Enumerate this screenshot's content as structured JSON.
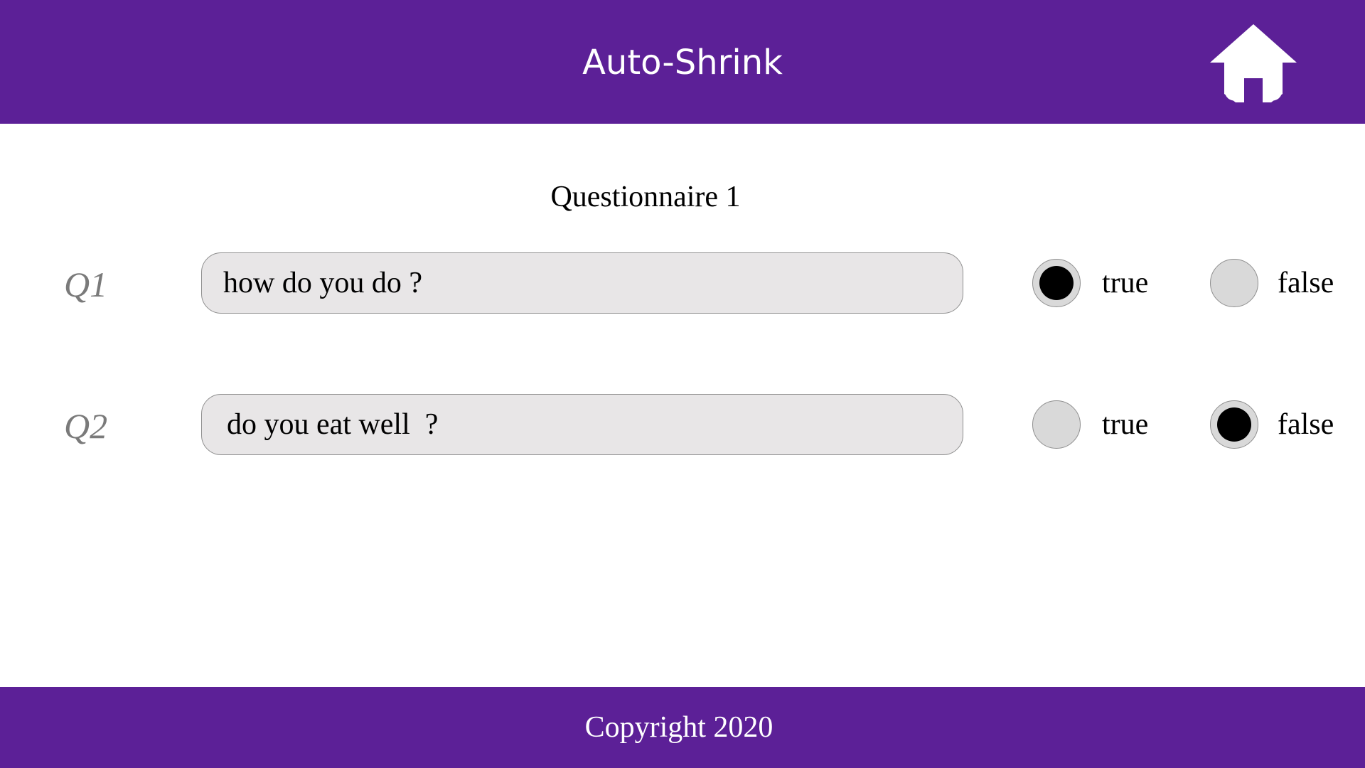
{
  "header": {
    "title": "Auto-Shrink",
    "home_icon": "home-icon",
    "color": "#5c2097"
  },
  "main": {
    "heading": "Questionnaire 1",
    "questions": [
      {
        "label": "Q1",
        "text": "how do you do ?",
        "options": [
          {
            "label": "true",
            "selected": true
          },
          {
            "label": "false",
            "selected": false
          }
        ]
      },
      {
        "label": "Q2",
        "text": "do you eat well  ?",
        "options": [
          {
            "label": "true",
            "selected": false
          },
          {
            "label": "false",
            "selected": true
          }
        ]
      }
    ]
  },
  "footer": {
    "copyright": "Copyright 2020"
  },
  "colors": {
    "brand": "#5c2097",
    "field_bg": "#e8e6e7",
    "radio_bg": "#d9d9d9",
    "radio_selected": "#000000",
    "question_label": "#7a7a7a"
  }
}
